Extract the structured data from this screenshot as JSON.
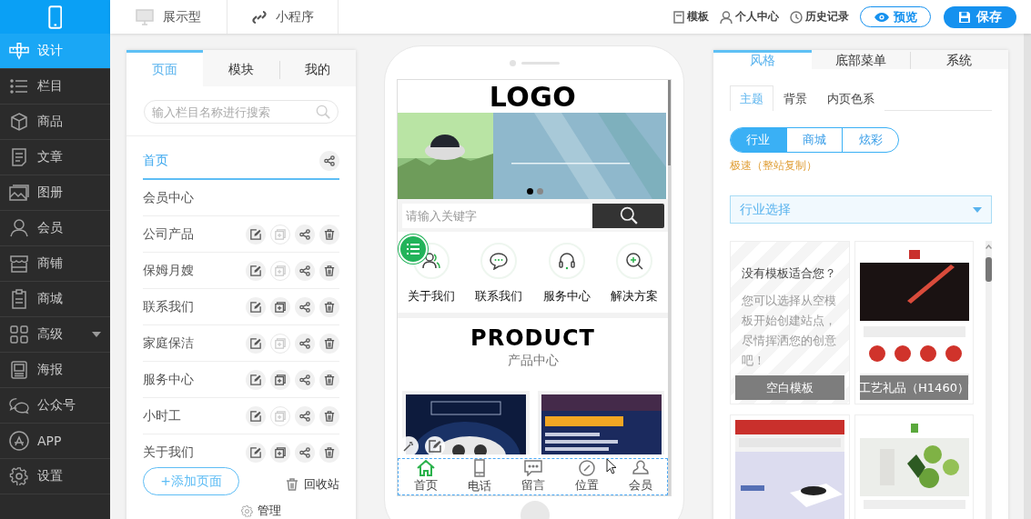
{
  "sidebar": {
    "items": [
      {
        "label": "设计",
        "selected": true,
        "has_submenu": false
      },
      {
        "label": "栏目",
        "selected": false,
        "has_submenu": false
      },
      {
        "label": "商品",
        "selected": false,
        "has_submenu": false
      },
      {
        "label": "文章",
        "selected": false,
        "has_submenu": false
      },
      {
        "label": "图册",
        "selected": false,
        "has_submenu": false
      },
      {
        "label": "会员",
        "selected": false,
        "has_submenu": false
      },
      {
        "label": "商铺",
        "selected": false,
        "has_submenu": false
      },
      {
        "label": "商城",
        "selected": false,
        "has_submenu": false
      },
      {
        "label": "高级",
        "selected": false,
        "has_submenu": true
      },
      {
        "label": "海报",
        "selected": false,
        "has_submenu": false
      },
      {
        "label": "公众号",
        "selected": false,
        "has_submenu": false
      },
      {
        "label": "APP",
        "selected": false,
        "has_submenu": false
      },
      {
        "label": "设置",
        "selected": false,
        "has_submenu": false
      }
    ]
  },
  "top_bar": {
    "modes": [
      "展示型",
      "小程序"
    ],
    "tools": [
      "模板",
      "个人中心",
      "历史记录"
    ],
    "preview_button": "预览",
    "save_button": "保存"
  },
  "page_panel": {
    "tabs": [
      {
        "label": "页面",
        "selected": true
      },
      {
        "label": "模块",
        "selected": false
      },
      {
        "label": "我的",
        "selected": false
      }
    ],
    "search": {
      "placeholder": "输入栏目名称进行搜索"
    },
    "pages": [
      {
        "label": "首页",
        "selected": true,
        "actions": [
          {
            "kind": "share",
            "disabled": false
          }
        ]
      },
      {
        "label": "会员中心",
        "selected": false
      },
      {
        "label": "公司产品",
        "selected": false,
        "actions": [
          {
            "kind": "edit",
            "disabled": false
          },
          {
            "kind": "copy",
            "disabled": true
          },
          {
            "kind": "share",
            "disabled": false
          },
          {
            "kind": "delete",
            "disabled": false
          }
        ]
      },
      {
        "label": "保姆月嫂",
        "selected": false,
        "actions": [
          {
            "kind": "edit",
            "disabled": false
          },
          {
            "kind": "copy",
            "disabled": true
          },
          {
            "kind": "share",
            "disabled": false
          },
          {
            "kind": "delete",
            "disabled": false
          }
        ]
      },
      {
        "label": "联系我们",
        "selected": false,
        "actions": [
          {
            "kind": "edit",
            "disabled": false
          },
          {
            "kind": "copy",
            "disabled": false
          },
          {
            "kind": "share",
            "disabled": false
          },
          {
            "kind": "delete",
            "disabled": false
          }
        ]
      },
      {
        "label": "家庭保洁",
        "selected": false,
        "actions": [
          {
            "kind": "edit",
            "disabled": false
          },
          {
            "kind": "copy",
            "disabled": true
          },
          {
            "kind": "share",
            "disabled": false
          },
          {
            "kind": "delete",
            "disabled": false
          }
        ]
      },
      {
        "label": "服务中心",
        "selected": false,
        "actions": [
          {
            "kind": "edit",
            "disabled": false
          },
          {
            "kind": "copy",
            "disabled": false
          },
          {
            "kind": "share",
            "disabled": false
          },
          {
            "kind": "delete",
            "disabled": false
          }
        ]
      },
      {
        "label": "小时工",
        "selected": false,
        "actions": [
          {
            "kind": "edit",
            "disabled": false
          },
          {
            "kind": "copy",
            "disabled": true
          },
          {
            "kind": "share",
            "disabled": false
          },
          {
            "kind": "delete",
            "disabled": false
          }
        ]
      },
      {
        "label": "关于我们",
        "selected": false,
        "actions": [
          {
            "kind": "edit",
            "disabled": false
          },
          {
            "kind": "copy",
            "disabled": false
          },
          {
            "kind": "share",
            "disabled": false
          },
          {
            "kind": "delete",
            "disabled": false
          }
        ]
      }
    ],
    "add_button": "+添加页面",
    "recycle_bin": "回收站",
    "manage": "管理"
  },
  "phone_preview": {
    "logo": "LOGO",
    "banner": {
      "kind": "picture",
      "dots": [
        {
          "selected": true
        },
        {
          "selected": false
        }
      ]
    },
    "search": {
      "placeholder": "请输入关键字"
    },
    "nav": [
      "关于我们",
      "联系我们",
      "服务中心",
      "解决方案"
    ],
    "product_section": {
      "title": "PRODUCT",
      "subtitle": "产品中心",
      "products": [
        {
          "kind": "picture"
        },
        {
          "kind": "picture"
        }
      ]
    },
    "tab_bar": [
      {
        "label": "首页",
        "selected": true
      },
      {
        "label": "电话",
        "selected": false
      },
      {
        "label": "留言",
        "selected": false
      },
      {
        "label": "位置",
        "selected": false
      },
      {
        "label": "会员",
        "selected": false
      }
    ]
  },
  "style_panel": {
    "tabs": [
      {
        "label": "风格",
        "selected": true
      },
      {
        "label": "底部菜单",
        "selected": false
      },
      {
        "label": "系统",
        "selected": false
      }
    ],
    "subtabs": [
      {
        "label": "主题",
        "selected": true
      },
      {
        "label": "背景",
        "selected": false
      },
      {
        "label": "内页色系",
        "selected": false
      }
    ],
    "categories": [
      {
        "label": "行业",
        "selected": true
      },
      {
        "label": "商城",
        "selected": false
      },
      {
        "label": "炫彩",
        "selected": false
      }
    ],
    "notice": "极速（整站复制）",
    "industry_select": {
      "placeholder": "行业选择"
    },
    "templates": [
      {
        "kind": "blank",
        "question": "没有模板适合您？",
        "description": "您可以选择从空模板开始创建站点，尽情挥洒您的创意吧！",
        "caption": "空白模板"
      },
      {
        "kind": "picture",
        "caption": "工艺礼品（H1460）"
      },
      {
        "kind": "picture"
      },
      {
        "kind": "picture"
      }
    ]
  }
}
